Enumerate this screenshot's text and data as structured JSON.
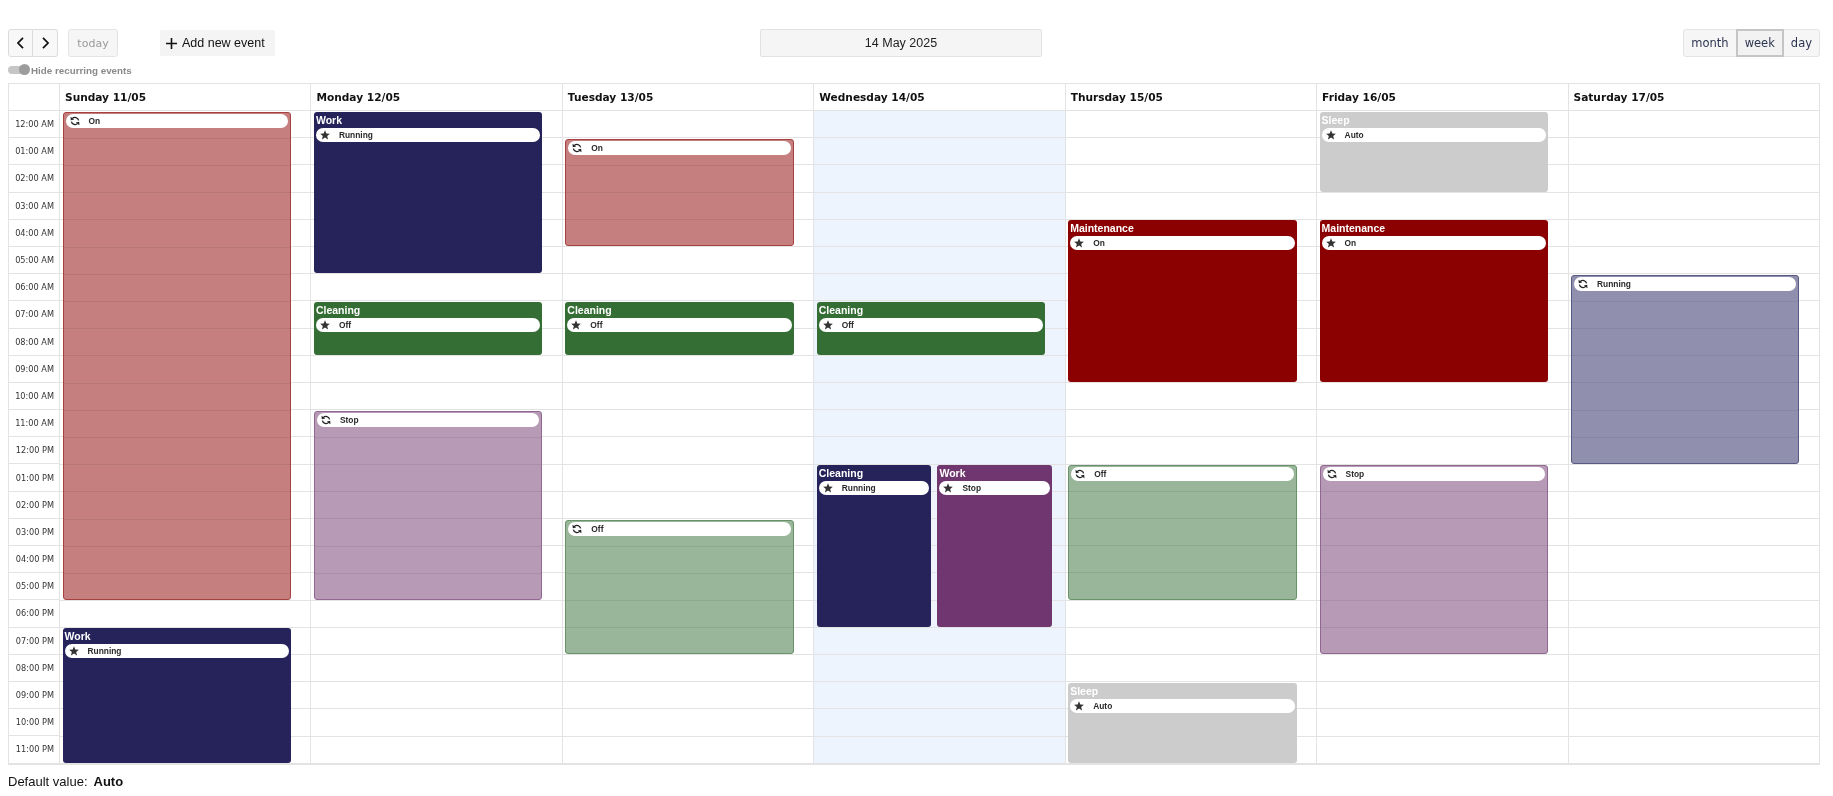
{
  "toolbar": {
    "today": "today",
    "add_event": "Add new event",
    "date": "14 May 2025",
    "views": [
      {
        "label": "month",
        "selected": false
      },
      {
        "label": "week",
        "selected": true
      },
      {
        "label": "day",
        "selected": false
      }
    ]
  },
  "recurring_toggle": {
    "label": "Hide recurring events",
    "on": false
  },
  "calendar": {
    "times": [
      "12:00 AM",
      "01:00 AM",
      "02:00 AM",
      "03:00 AM",
      "04:00 AM",
      "05:00 AM",
      "06:00 AM",
      "07:00 AM",
      "08:00 AM",
      "09:00 AM",
      "10:00 AM",
      "11:00 AM",
      "12:00 PM",
      "01:00 PM",
      "02:00 PM",
      "03:00 PM",
      "04:00 PM",
      "05:00 PM",
      "06:00 PM",
      "07:00 PM",
      "08:00 PM",
      "09:00 PM",
      "10:00 PM",
      "11:00 PM"
    ],
    "days": [
      {
        "label": "Sunday 11/05",
        "today": false,
        "events": [
          {
            "status": "On",
            "recurring": true,
            "color": "#c57f7f"
          },
          {
            "title": "Work",
            "status": "Running",
            "recurring": false,
            "color": "#25235a"
          }
        ]
      },
      {
        "label": "Monday 12/05",
        "today": false,
        "events": [
          {
            "title": "Work",
            "status": "Running",
            "recurring": false,
            "color": "#25235a"
          },
          {
            "title": "Cleaning",
            "status": "Off",
            "recurring": false,
            "color": "#356e35"
          },
          {
            "status": "Stop",
            "recurring": true,
            "color": "#b69ab6"
          }
        ]
      },
      {
        "label": "Tuesday 13/05",
        "today": false,
        "events": [
          {
            "status": "On",
            "recurring": true,
            "color": "#c57f7f"
          },
          {
            "title": "Cleaning",
            "status": "Off",
            "recurring": false,
            "color": "#356e35"
          },
          {
            "status": "Off",
            "recurring": true,
            "color": "#9ab69a"
          }
        ]
      },
      {
        "label": "Wednesday 14/05",
        "today": true,
        "events": [
          {
            "title": "Cleaning",
            "status": "Off",
            "recurring": false,
            "color": "#356e35"
          },
          {
            "title": "Cleaning",
            "status": "Running",
            "recurring": false,
            "color": "#25235a"
          },
          {
            "title": "Work",
            "status": "Stop",
            "recurring": false,
            "color": "#6f366f"
          }
        ]
      },
      {
        "label": "Thursday 15/05",
        "today": false,
        "events": [
          {
            "title": "Maintenance",
            "status": "On",
            "recurring": false,
            "color": "#8b0000"
          },
          {
            "status": "Off",
            "recurring": true,
            "color": "#9ab69a"
          },
          {
            "title": "Sleep",
            "status": "Auto",
            "recurring": false,
            "color": "#cccccc"
          }
        ]
      },
      {
        "label": "Friday 16/05",
        "today": false,
        "events": [
          {
            "title": "Sleep",
            "status": "Auto",
            "recurring": false,
            "color": "#cccccc"
          },
          {
            "title": "Maintenance",
            "status": "On",
            "recurring": false,
            "color": "#8b0000"
          },
          {
            "status": "Stop",
            "recurring": true,
            "color": "#b69ab6"
          }
        ]
      },
      {
        "label": "Saturday 17/05",
        "today": false,
        "events": [
          {
            "status": "Running",
            "recurring": true,
            "color": "#9090ae"
          }
        ]
      }
    ]
  },
  "default_value": {
    "label": "Default value:",
    "value": "Auto"
  }
}
